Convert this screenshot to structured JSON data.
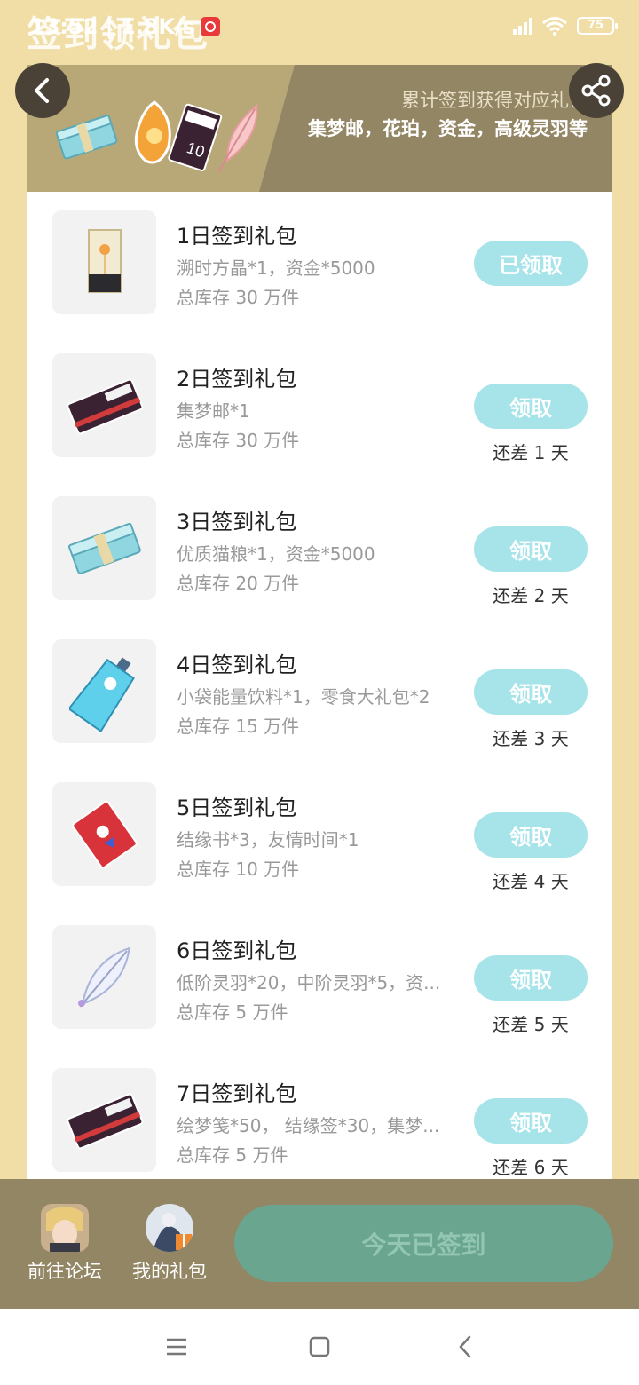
{
  "status_bar": {
    "page_title_ghost": "签到领礼包",
    "time_speed": "13:52 | 1.8K/s",
    "right_ghost": "领礼包得",
    "battery": "75"
  },
  "banner": {
    "subtitle": "累计签到获得对应礼包",
    "rewards": "集梦邮，花珀，资金，高级灵羽等"
  },
  "gifts": [
    {
      "name": "1日签到礼包",
      "desc": "溯时方晶*1，资金*5000",
      "stock": "总库存 30 万件",
      "button": "已领取",
      "days_left": ""
    },
    {
      "name": "2日签到礼包",
      "desc": "集梦邮*1",
      "stock": "总库存 30 万件",
      "button": "领取",
      "days_left": "还差 1 天"
    },
    {
      "name": "3日签到礼包",
      "desc": "优质猫粮*1，资金*5000",
      "stock": "总库存 20 万件",
      "button": "领取",
      "days_left": "还差 2 天"
    },
    {
      "name": "4日签到礼包",
      "desc": "小袋能量饮料*1，零食大礼包*2",
      "stock": "总库存 15 万件",
      "button": "领取",
      "days_left": "还差 3 天"
    },
    {
      "name": "5日签到礼包",
      "desc": "结缘书*3，友情时间*1",
      "stock": "总库存 10 万件",
      "button": "领取",
      "days_left": "还差 4 天"
    },
    {
      "name": "6日签到礼包",
      "desc": "低阶灵羽*20，中阶灵羽*5，资...",
      "stock": "总库存 5 万件",
      "button": "领取",
      "days_left": "还差 5 天"
    },
    {
      "name": "7日签到礼包",
      "desc": "绘梦笺*50， 结缘签*30，集梦...",
      "stock": "总库存 5 万件",
      "button": "领取",
      "days_left": "还差 6 天"
    }
  ],
  "action_bar": {
    "forum_label": "前往论坛",
    "my_gifts_label": "我的礼包",
    "signed_label": "今天已签到"
  },
  "colors": {
    "page_bg": "#f0dea6",
    "banner_dark": "#938664",
    "claim_button": "#a6e4ea",
    "signed_button": "#6aa590"
  },
  "icons": [
    "back-arrow-icon",
    "share-icon",
    "home-icon",
    "recents-icon",
    "nav-back-icon"
  ]
}
